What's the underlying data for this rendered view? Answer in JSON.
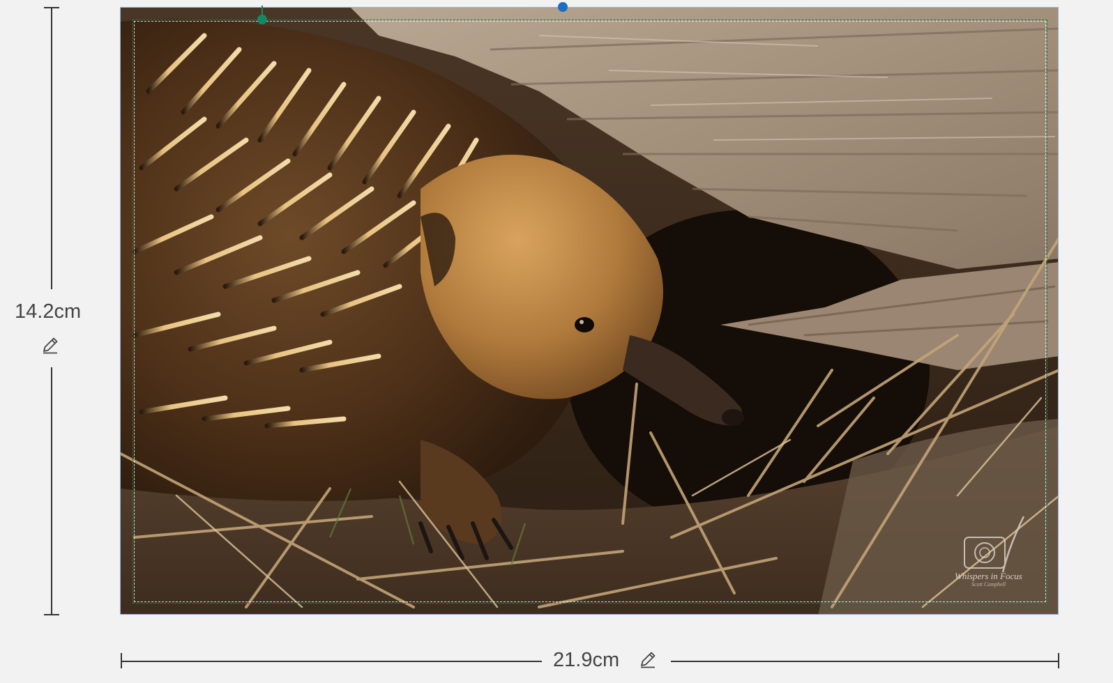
{
  "dimensions": {
    "height_label": "14.2cm",
    "width_label": "21.9cm"
  },
  "image": {
    "watermark_text": "Whispers in Focus",
    "watermark_subtext": "Scott Campbell"
  },
  "colors": {
    "background": "#f2f2f2",
    "selection_border": "#8fb3d9",
    "crop_border": "#1d7a5a",
    "rotate_handle": "#1a6fc4",
    "crop_handle": "#138a64"
  },
  "icons": {
    "edit": "pencil-icon",
    "watermark": "camera-feather-logo"
  }
}
